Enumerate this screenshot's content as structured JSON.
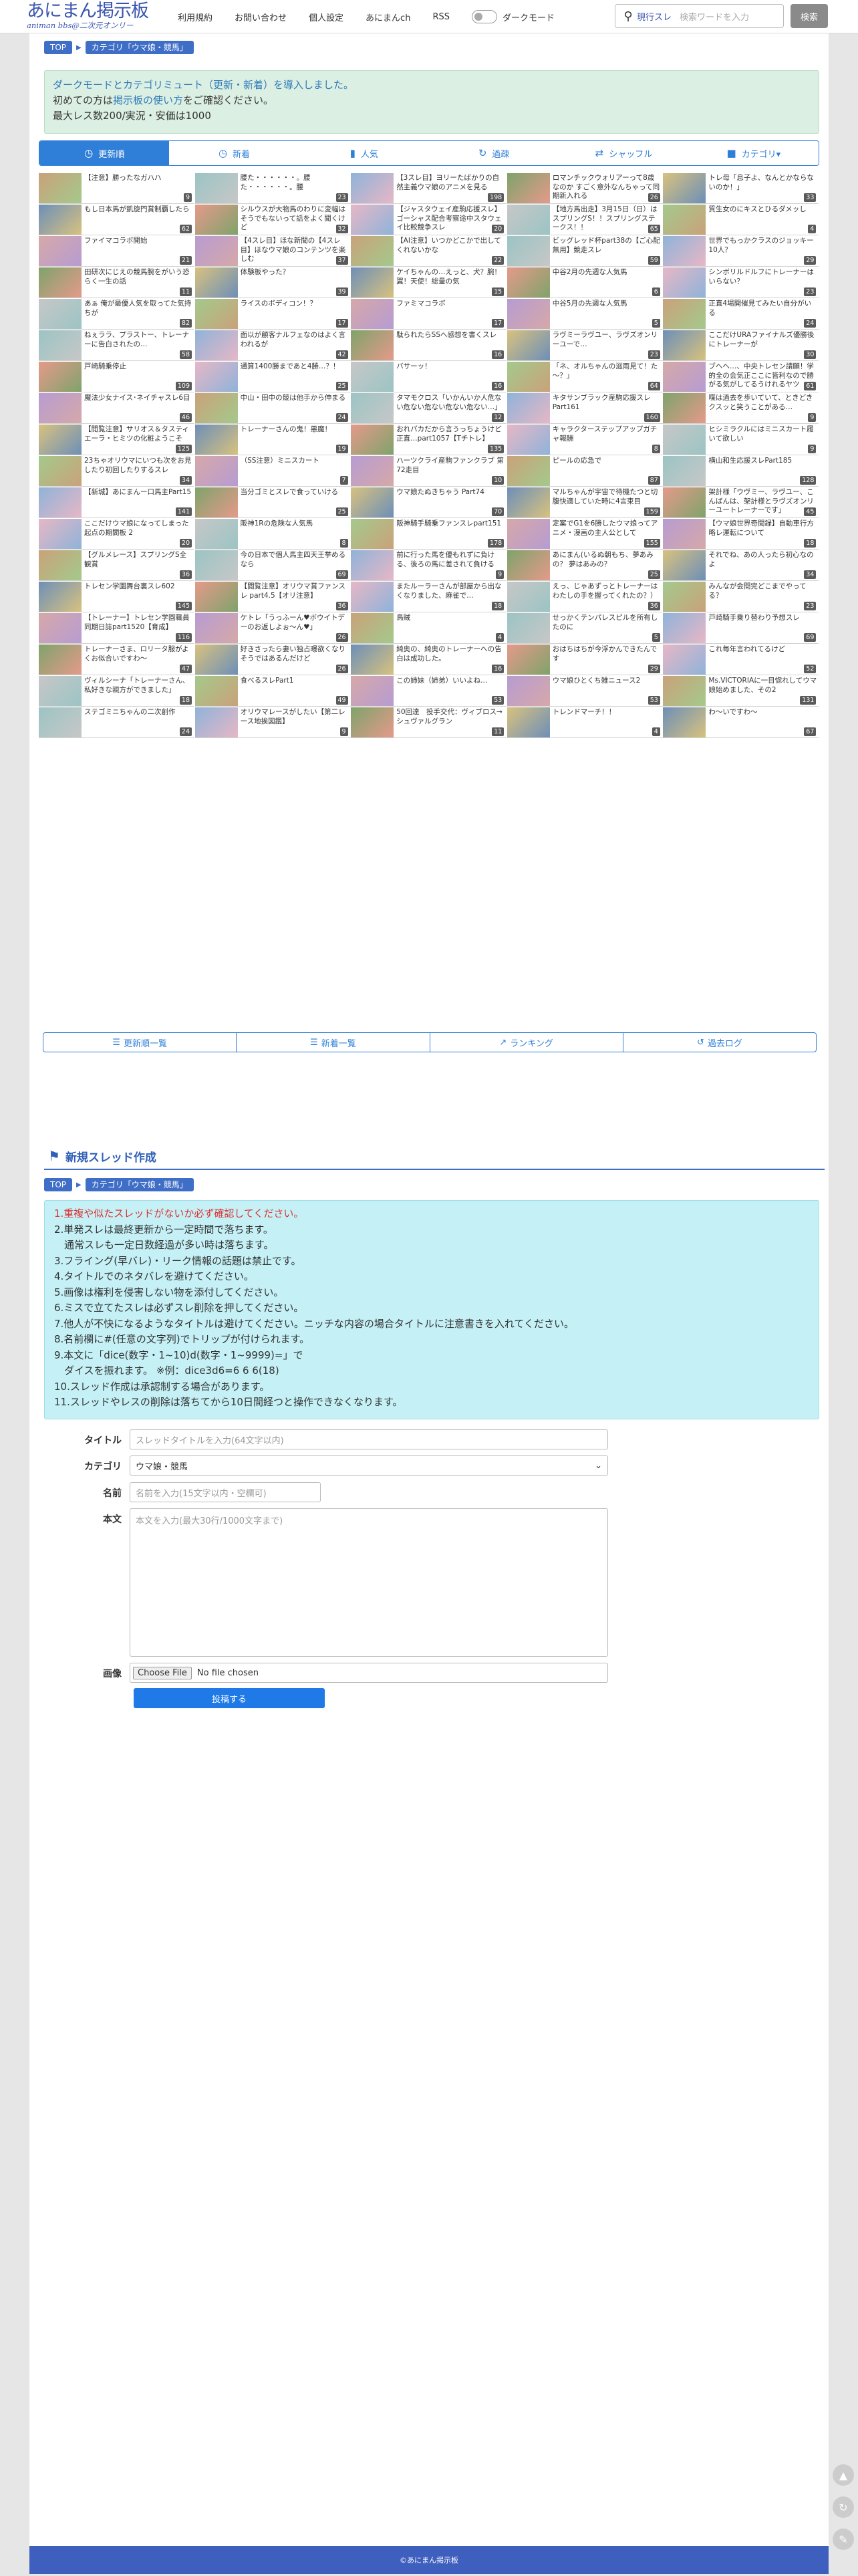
{
  "site": {
    "logo_title": "あにまん掲示板",
    "logo_sub": "animan bbs@二次元オンリー"
  },
  "nav": [
    "利用規約",
    "お問い合わせ",
    "個人設定",
    "あにまんch",
    "RSS"
  ],
  "dark_mode_label": "ダークモード",
  "search": {
    "mode": "現行スレ",
    "placeholder": "検索ワードを入力",
    "button": "検索"
  },
  "breadcrumb": {
    "top": "TOP",
    "category": "カテゴリ「ウマ娘・競馬」"
  },
  "notice": {
    "line1": "ダークモードとカテゴリミュート（更新・新着）を導入しました。",
    "line2_pre": "初めての方は",
    "line2_link": "掲示板の使い方",
    "line2_post": "をご確認ください。",
    "line3": "最大レス数200/実況・安価は1000"
  },
  "tabs": [
    {
      "label": "更新順",
      "icon": "clock-icon"
    },
    {
      "label": "新着",
      "icon": "clock-icon"
    },
    {
      "label": "人気",
      "icon": "bars-icon"
    },
    {
      "label": "過疎",
      "icon": "refresh-icon"
    },
    {
      "label": "シャッフル",
      "icon": "shuffle-icon"
    },
    {
      "label": "カテゴリ▾",
      "icon": "folder-icon"
    }
  ],
  "threads": [
    {
      "title": "【注意】勝ったなガハハ",
      "count": "9"
    },
    {
      "title": "腰た・・・・・・。腰た・・・・・・。腰",
      "count": "23"
    },
    {
      "title": "【3スレ目】ヨリーたばかりの自然主義ウマ娘のアニメを見る",
      "count": "198"
    },
    {
      "title": "ロマンチックウォリアーって8歳なのか すごく意外なんちゃって同期新入れる",
      "count": "26"
    },
    {
      "title": "トレ母「息子よ、なんとかならないのか！」",
      "count": "33"
    },
    {
      "title": "もし日本馬が凱旋門賞制覇したら",
      "count": "62"
    },
    {
      "title": "シルウスが大物馬のわりに変幅はそうでもないって話をよく聞くけど",
      "count": "32"
    },
    {
      "title": "【ジャスタウェイ産駒応援スレ】ゴーシャス配合考察途中スタウェイ比較競争スレ",
      "count": "20"
    },
    {
      "title": "【地方馬出走】3月15日（日）はスプリングS！！スプリングステークス！！",
      "count": "65"
    },
    {
      "title": "質生女のにキスとひるダメッし",
      "count": "4"
    },
    {
      "title": "ファイマコラボ開始",
      "count": "21"
    },
    {
      "title": "【4スレ目】ほな新聞の【4スレ目】ほなウマ娘のコンテンツを楽しむ",
      "count": "37"
    },
    {
      "title": "【AI注意】いつかどこかで出してくれないかな",
      "count": "22"
    },
    {
      "title": "ビッグレッド杯part38の【ご心配無用】競走スレ",
      "count": "59"
    },
    {
      "title": "世界でもっかクラスのジョッキー10人？",
      "count": "29"
    },
    {
      "title": "田研次にじえの競馬腕をがいう恐らく一生の話",
      "count": "11"
    },
    {
      "title": "体験板やった？",
      "count": "39"
    },
    {
      "title": "ケイちゃんの…えっと、犬？腕！翼！天使！総量の気",
      "count": "15"
    },
    {
      "title": "中谷2月の先週な人気馬",
      "count": "6"
    },
    {
      "title": "シンボリルドルフにトレーナーはいらない？",
      "count": "23"
    },
    {
      "title": "あぁ 俺が最優人気を取ってた気持ちが",
      "count": "82"
    },
    {
      "title": "ライスのボディコン！？",
      "count": "17"
    },
    {
      "title": "ファミマコラボ",
      "count": "17"
    },
    {
      "title": "中谷5月の先週な人気馬",
      "count": "5"
    },
    {
      "title": "正直4場開催見てみたい自分がいる",
      "count": "24"
    },
    {
      "title": "ねぇララ、プラストー、トレーナーに告白されたの…",
      "count": "58"
    },
    {
      "title": "面以が顧客ナルフェなのはよく言われるが",
      "count": "42"
    },
    {
      "title": "駄られたらSSへ感想を書くスレ",
      "count": "16"
    },
    {
      "title": "ラヴミーラヴユー、ラヴズオンリーユーで…",
      "count": "23"
    },
    {
      "title": "ここだけURAファイナルズ優勝後にトレーナーが",
      "count": "30"
    },
    {
      "title": "戸崎騎乗停止",
      "count": "109"
    },
    {
      "title": "通算1400勝まであと4勝…？！",
      "count": "25"
    },
    {
      "title": "バサーッ！",
      "count": "16"
    },
    {
      "title": "「ネ、オルちゃんの滋雨見て！た～？」",
      "count": "64"
    },
    {
      "title": "ブヘヘ…、中央トレセン請願！学的全の会気正ここに皆利なので勝がる気がしてるうけれるヤツ",
      "count": "61"
    },
    {
      "title": "魔法少女ナイス･ネイチャスレ6目",
      "count": "46"
    },
    {
      "title": "中山・田中の競は他手から伸まる",
      "count": "24"
    },
    {
      "title": "タマモクロス「いかんいか人危ない危ない危ない危ない危ない…」",
      "count": "12"
    },
    {
      "title": "キタサンブラック産駒応援スレ Part161",
      "count": "160"
    },
    {
      "title": "喋は過去を歩いていて、ときどきクスッと笑うことがある…",
      "count": "9"
    },
    {
      "title": "【閲覧注意】サリオス＆タスティエーラ・ヒミツの化粧ようこそ",
      "count": "125"
    },
    {
      "title": "トレーナーさんの鬼！悪魔！",
      "count": "19"
    },
    {
      "title": "おれパカだから言うっちょうけど正直…part1057【Tチトレ】",
      "count": "135"
    },
    {
      "title": "キャラクターステップアップガチャ報酬",
      "count": "8"
    },
    {
      "title": "ヒシミラクルにはミニスカート履いて欲しい",
      "count": "9"
    },
    {
      "title": "23ちゃオリウマにいつも次をお見したり初回したりするスレ",
      "count": "34"
    },
    {
      "title": "（SS注意）ミニスカート",
      "count": "7"
    },
    {
      "title": "ハーツクライ産駒ファンクラブ 第72走目",
      "count": "10"
    },
    {
      "title": "ピールの応急で",
      "count": "87"
    },
    {
      "title": "横山和生応援スレPart185",
      "count": "128"
    },
    {
      "title": "【新城】あにまんー口馬主Part15",
      "count": "141"
    },
    {
      "title": "当分ゴミとスレで食っていける",
      "count": "25"
    },
    {
      "title": "ウマ娘たぬきちゃう Part74",
      "count": "70"
    },
    {
      "title": "マルちゃんが宇宙で待機たつと切腹快適していた時に4言束目",
      "count": "159"
    },
    {
      "title": "架計様「ウヴミー、ラヴユー、こんばんは、架計様とラヴズオンリーユートレーナーです」",
      "count": "45"
    },
    {
      "title": "ここだけウマ娘になってしまった起点の期間板 2",
      "count": "20"
    },
    {
      "title": "阪神1Rの危険な人気馬",
      "count": "8"
    },
    {
      "title": "阪神騎手騎乗ファンスレpart151",
      "count": "178"
    },
    {
      "title": "定案でG1を6勝したウマ娘ってアニメ・漫画の主人公として",
      "count": "155"
    },
    {
      "title": "【ウマ娘世界奇聞録】自動車行方略レ運転について",
      "count": "18"
    },
    {
      "title": "【グルメレース】スプリングS全観賞",
      "count": "36"
    },
    {
      "title": "今の日本で個人馬主四天王挙めるなら",
      "count": "69"
    },
    {
      "title": "前に行った馬を優もれずに負ける、後ろの馬に差されて負ける",
      "count": "9"
    },
    {
      "title": "あにまん(いるぬ朝もち、夢あみの？ 夢はあみの？",
      "count": "25"
    },
    {
      "title": "それでね、あの人ったら初心なのよ",
      "count": "34"
    },
    {
      "title": "トレセン学園舞台裏スレ602",
      "count": "145"
    },
    {
      "title": "【閲覧注意】オリウマ賞ファンスレ part4.5【オリ注意】",
      "count": "36"
    },
    {
      "title": "またルーラーさんが部屋から出なくなりました、麻雀で…",
      "count": "18"
    },
    {
      "title": "えっ、じゃあずっとトレーナーはわたしの手を握ってくれたの？）",
      "count": "36"
    },
    {
      "title": "みんなが会間完どこまでやってる？",
      "count": "23"
    },
    {
      "title": "【トレーナー】トレセン学園職員同期日誌part1520【育成】",
      "count": "116"
    },
    {
      "title": "ケトレ「うっふーん♥ボウイトデーのお返しよぉ～ん♥」",
      "count": "26"
    },
    {
      "title": "鳥賊",
      "count": "4"
    },
    {
      "title": "せっかくテンパレスピルを所有したのに",
      "count": "5"
    },
    {
      "title": "戸崎騎手乗り替わり予想スレ",
      "count": "69"
    },
    {
      "title": "トレーナーさま、ロリータ服がよくお似合いですわ〜",
      "count": "47"
    },
    {
      "title": "好きさったら妻い独占曝欲くなりそうではあるんだけど",
      "count": "26"
    },
    {
      "title": "綺奥の、綺奥のトレーナーへの告白は成功した。",
      "count": "16"
    },
    {
      "title": "おはちはちが今浮かんできたんです",
      "count": "29"
    },
    {
      "title": "これ毎年言われてるけど",
      "count": "52"
    },
    {
      "title": "ヴィルシーナ「トレーナーさん、私好きな親方ができました」",
      "count": "18"
    },
    {
      "title": "食べるスレPart1",
      "count": "49"
    },
    {
      "title": "この姉妹（姉弟）いいよね…",
      "count": "53"
    },
    {
      "title": "ウマ娘ひとくち雑ニュース2",
      "count": "53"
    },
    {
      "title": "Ms.VICTORIAに一目惚れしてウマ娘始めました、その2",
      "count": "131"
    },
    {
      "title": "ステゴミニちゃんの二次創作",
      "count": "24"
    },
    {
      "title": "オリウマレースがしたい【第二レース地挨図鑑】",
      "count": "9"
    },
    {
      "title": "50回達　投手交代：ヴィブロス→シュヴァルグラン",
      "count": "11"
    },
    {
      "title": "トレンドマーチ！！",
      "count": "4"
    },
    {
      "title": "わ～いですわ〜",
      "count": "67"
    }
  ],
  "bottom_nav": [
    {
      "label": "更新順一覧",
      "icon": "list-icon"
    },
    {
      "label": "新着一覧",
      "icon": "list-icon"
    },
    {
      "label": "ランキング",
      "icon": "chart-icon"
    },
    {
      "label": "過去ログ",
      "icon": "history-icon"
    }
  ],
  "new_thread": {
    "title": "新規スレッド作成"
  },
  "rules": [
    "1.重複や似たスレッドがないか必ず確認してください。",
    "2.単発スレは最終更新から一定時間で落ちます。",
    "　通常スレも一定日数経過が多い時は落ちます。",
    "3.フライング(早バレ)・リーク情報の話題は禁止です。",
    "4.タイトルでのネタバレを避けてください。",
    "5.画像は権利を侵害しない物を添付してください。",
    "6.ミスで立てたスレは必ずスレ削除を押してください。",
    "7.他人が不快になるようなタイトルは避けてください。ニッチな内容の場合タイトルに注意書きを入れてください。",
    "8.名前欄に#(任意の文字列)でトリップが付けられます。",
    "9.本文に「dice(数字・1~10)d(数字・1~9999)=」で",
    "　ダイスを振れます。 ※例：dice3d6=6 6 6(18)",
    "10.スレッド作成は承認制する場合があります。",
    "11.スレッドやレスの削除は落ちてから10日間経つと操作できなくなります。"
  ],
  "form": {
    "title_label": "タイトル",
    "title_ph": "スレッドタイトルを入力(64文字以内)",
    "cat_label": "カテゴリ",
    "cat_value": "ウマ娘・競馬",
    "name_label": "名前",
    "name_ph": "名前を入力(15文字以内・空欄可)",
    "body_label": "本文",
    "body_ph": "本文を入力(最大30行/1000文字まで)",
    "image_label": "画像",
    "file_btn": "Choose File",
    "file_none": "No file chosen",
    "submit": "投稿する"
  },
  "footer": "©あにまん掲示板",
  "colors": {
    "accent": "#2f7fd8",
    "header_blue": "#3a55b0",
    "notice_bg": "#dcefe3",
    "rules_bg": "#c5f1f6",
    "red": "#dd3333"
  }
}
